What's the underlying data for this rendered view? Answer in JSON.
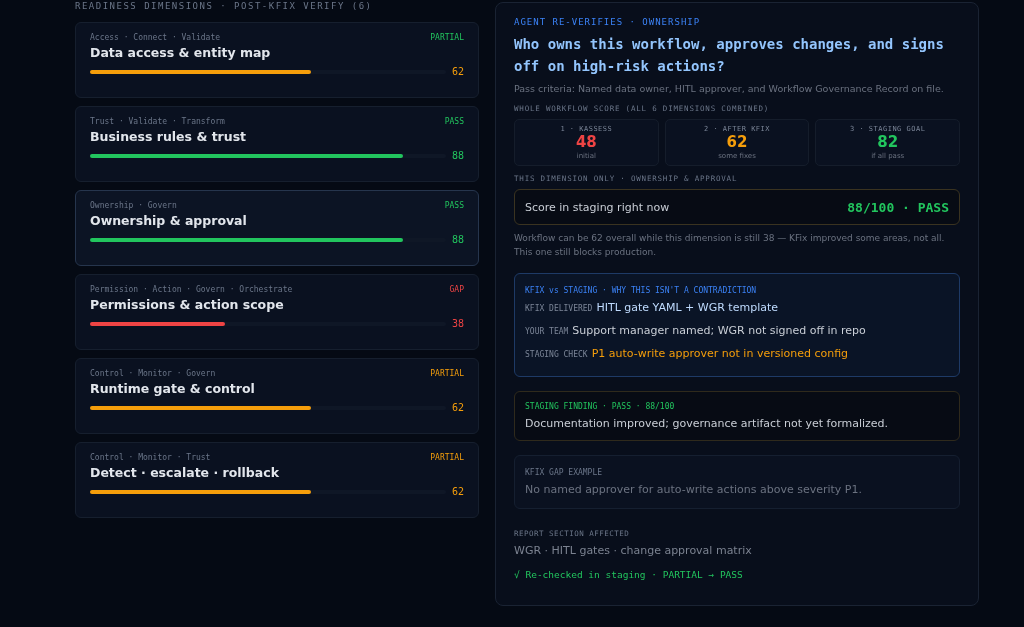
{
  "dimensions": {
    "heading": "READINESS DIMENSIONS · POST-KFIX VERIFY (6)",
    "items": [
      {
        "tags": "Access · Connect · Validate",
        "status": "PARTIAL",
        "kind": "ok",
        "title": "Data access & entity map",
        "level": 0.62,
        "score": "62",
        "color": "#f59e0b",
        "selected": false
      },
      {
        "tags": "Trust · Validate · Transform",
        "status": "PASS",
        "kind": "ok",
        "title": "Business rules & trust",
        "level": 0.88,
        "score": "88",
        "color": "#22c55e",
        "selected": false
      },
      {
        "tags": "Ownership · Govern",
        "status": "PASS",
        "kind": "ok",
        "title": "Ownership & approval",
        "level": 0.88,
        "score": "88",
        "color": "#22c55e",
        "selected": true
      },
      {
        "tags": "Permission · Action · Govern · Orchestrate",
        "status": "GAP",
        "kind": "bad",
        "title": "Permissions & action scope",
        "level": 0.38,
        "score": "38",
        "color": "#ef4444",
        "selected": false
      },
      {
        "tags": "Control · Monitor · Govern",
        "status": "PARTIAL",
        "kind": "warn",
        "title": "Runtime gate & control",
        "level": 0.62,
        "score": "62",
        "color": "#f59e0b",
        "selected": false
      },
      {
        "tags": "Control · Monitor · Trust",
        "status": "PARTIAL",
        "kind": "warn",
        "title": "Detect · escalate · rollback",
        "level": 0.62,
        "score": "62",
        "color": "#f59e0b",
        "selected": false
      }
    ]
  },
  "detail": {
    "eyebrow": "AGENT RE-VERIFIES · OWNERSHIP",
    "question": "Who owns this workflow, approves changes, and signs off on high-risk actions?",
    "criteria": "Pass criteria: Named data owner, HITL approver, and Workflow Governance Record on file.",
    "workflow_heading": "WHOLE WORKFLOW SCORE (ALL 6 DIMENSIONS COMBINED)",
    "scores": [
      {
        "label": "1 · KASSESS",
        "value": "48",
        "note": "initial",
        "color": "#ef4444"
      },
      {
        "label": "2 · AFTER KFIX",
        "value": "62",
        "note": "some fixes",
        "color": "#f59e0b"
      },
      {
        "label": "3 · STAGING GOAL",
        "value": "82",
        "note": "if all pass",
        "color": "#22c55e"
      }
    ],
    "dimension_heading": "THIS DIMENSION ONLY · OWNERSHIP & APPROVAL",
    "staging_label": "Score in staging right now",
    "staging_value": "88/100 · PASS",
    "explanation": "Workflow can be 62 overall while this dimension is still 38 — KFix improved some areas, not all. This one still blocks production.",
    "contrast": {
      "heading": "KFIX vs STAGING · WHY THIS ISN'T A CONTRADICTION",
      "rows": [
        {
          "key": "KFIX DELIVERED",
          "value": "HITL gate YAML + WGR template",
          "kind": "delivered"
        },
        {
          "key": "YOUR TEAM",
          "value": "Support manager named; WGR not signed off in repo",
          "kind": "team"
        },
        {
          "key": "STAGING CHECK",
          "value": "P1 auto-write approver not in versioned config",
          "kind": "warning"
        }
      ]
    },
    "finding": {
      "heading": "STAGING FINDING · PASS · 88/100",
      "text": "Documentation improved; governance artifact not yet formalized."
    },
    "gap": {
      "heading": "KFIX GAP EXAMPLE",
      "text": "No named approver for auto-write actions above severity P1."
    },
    "report_heading": "REPORT SECTION AFFECTED",
    "report_text": "WGR · HITL gates · change approval matrix",
    "recheck": "√ Re-checked in staging · PARTIAL → PASS"
  }
}
